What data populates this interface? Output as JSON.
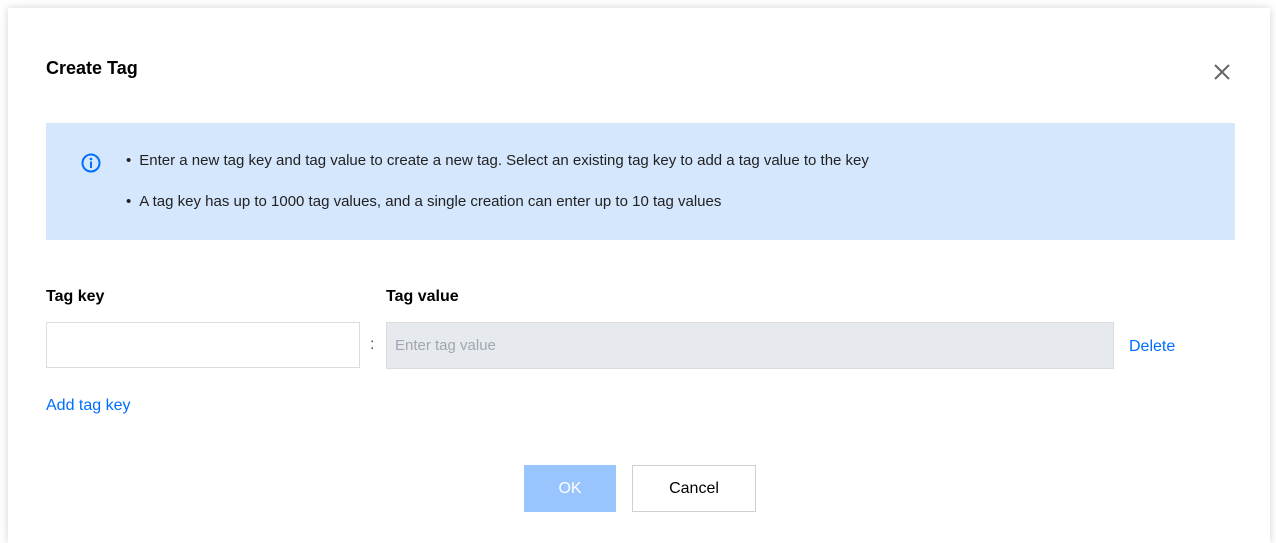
{
  "dialog": {
    "title": "Create Tag",
    "close_icon": "close-icon"
  },
  "info": {
    "icon": "info-icon",
    "items": [
      "Enter a new tag key and tag value to create a new tag. Select an existing tag key to add a tag value to the key",
      "A tag key has up to 1000 tag values, and a single creation can enter up to 10 tag values"
    ]
  },
  "form": {
    "tag_key_label": "Tag key",
    "tag_value_label": "Tag value",
    "tag_key_value": "",
    "separator": ":",
    "tag_value_placeholder": "Enter tag value",
    "delete_label": "Delete",
    "add_tag_key_label": "Add tag key"
  },
  "buttons": {
    "ok_label": "OK",
    "cancel_label": "Cancel"
  },
  "colors": {
    "accent": "#006eff",
    "info_background": "#d5e7fd",
    "ok_disabled": "#99c5ff",
    "disabled_input": "#e6e9ee"
  }
}
